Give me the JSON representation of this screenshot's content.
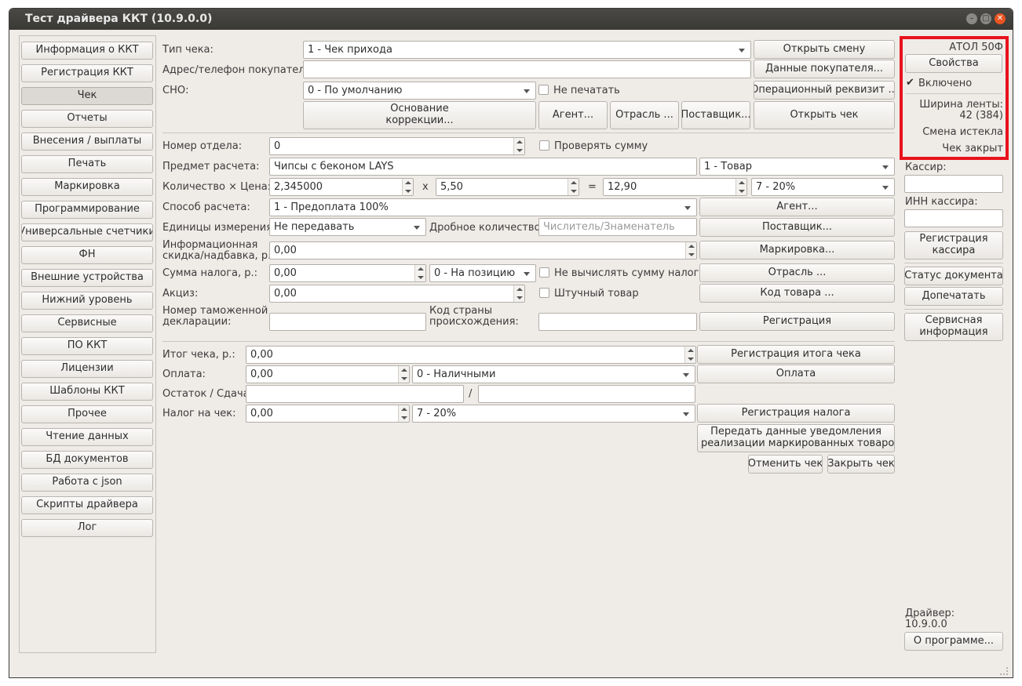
{
  "window": {
    "title": "Тест драйвера ККТ (10.9.0.0)"
  },
  "sidebar": {
    "items": [
      "Информация о ККТ",
      "Регистрация ККТ",
      "Чек",
      "Отчеты",
      "Внесения / выплаты",
      "Печать",
      "Маркировка",
      "Программирование",
      "Универсальные счетчики",
      "ФН",
      "Внешние устройства",
      "Нижний уровень",
      "Сервисные",
      "ПО ККТ",
      "Лицензии",
      "Шаблоны ККТ",
      "Прочее",
      "Чтение данных",
      "БД документов",
      "Работа с json",
      "Скрипты драйвера",
      "Лог"
    ],
    "selected": "Чек"
  },
  "receipt": {
    "type_label": "Тип чека:",
    "type_value": "1 - Чек прихода",
    "open_shift": "Открыть смену",
    "buyer_address_label": "Адрес/телефон покупателя:",
    "buyer_address_value": "",
    "buyer_data": "Данные покупателя...",
    "sno_label": "СНО:",
    "sno_value": "0 - По умолчанию",
    "no_print_label": "Не печатать",
    "op_requisite": "Операционный реквизит ...",
    "correction_basis_line1": "Основание",
    "correction_basis_line2": "коррекции...",
    "agent": "Агент...",
    "industry": "Отрасль ...",
    "supplier": "Поставщик...",
    "open_receipt": "Открыть чек"
  },
  "position": {
    "dept_label": "Номер отдела:",
    "dept_value": "0",
    "check_sum_label": "Проверять сумму",
    "subject_label": "Предмет расчета:",
    "subject_value": "Чипсы с беконом LAYS",
    "subject_type": "1 - Товар",
    "qty_price_label": "Количество × Цена:",
    "qty_value": "2,345000",
    "times": "x",
    "price_value": "5,50",
    "equals": "=",
    "sum_value": "12,90",
    "vat_value": "7 - 20%",
    "payment_method_label": "Способ расчета:",
    "payment_method_value": "1 - Предоплата 100%",
    "agent_btn": "Агент...",
    "units_label": "Единицы измерения:",
    "units_value": "Не передавать",
    "fraction_label": "Дробное количество:",
    "fraction_placeholder": "Числитель/Знаменатель",
    "supplier_btn": "Поставщик...",
    "discount_label_line1": "Информационная",
    "discount_label_line2": "скидка/надбавка, р.:",
    "discount_value": "0,00",
    "marking_btn": "Маркировка...",
    "tax_sum_label": "Сумма налога, р.:",
    "tax_sum_value": "0,00",
    "tax_position_value": "0 - На позицию",
    "no_calc_tax_label": "Не вычислять сумму налога",
    "industry_btn": "Отрасль ...",
    "excise_label": "Акциз:",
    "excise_value": "0,00",
    "piece_goods_label": "Штучный товар",
    "product_code_btn": "Код товара ...",
    "customs_label_line1": "Номер таможенной",
    "customs_label_line2": "декларации:",
    "customs_value": "",
    "country_label_line1": "Код страны",
    "country_label_line2": "происхождения:",
    "country_value": "",
    "register_btn": "Регистрация"
  },
  "totals": {
    "total_label": "Итог чека, р.:",
    "total_value": "0,00",
    "register_total_btn": "Регистрация итога чека",
    "payment_label": "Оплата:",
    "payment_value": "0,00",
    "payment_type": "0 - Наличными",
    "payment_btn": "Оплата",
    "change_label": "Остаток / Сдача:",
    "change_sep": "/",
    "tax_label": "Налог на чек:",
    "tax_value": "0,00",
    "tax_rate": "7 - 20%",
    "register_tax_btn": "Регистрация налога",
    "notify_line1": "Передать данные уведомления",
    "notify_line2": "о реализации маркированных товаров",
    "cancel_receipt": "Отменить чек",
    "close_receipt": "Закрыть чек"
  },
  "right_panel": {
    "model": "АТОЛ 50Ф",
    "properties": "Свойства",
    "enabled_label": "Включено",
    "enabled": true,
    "tape_width_line1": "Ширина ленты:",
    "tape_width_line2": "42 (384)",
    "shift_expired": "Смена истекла",
    "receipt_closed": "Чек закрыт",
    "cashier_label": "Кассир:",
    "cashier_value": "",
    "cashier_inn_label": "ИНН кассира:",
    "cashier_inn_value": "",
    "register_cashier_line1": "Регистрация",
    "register_cashier_line2": "кассира",
    "doc_status": "Статус документа",
    "reprint": "Допечатать",
    "service_info_line1": "Сервисная",
    "service_info_line2": "информация",
    "driver_label": "Драйвер:",
    "driver_version": "10.9.0.0",
    "about": "О программе...",
    "highlight_color": "#e8121b"
  }
}
